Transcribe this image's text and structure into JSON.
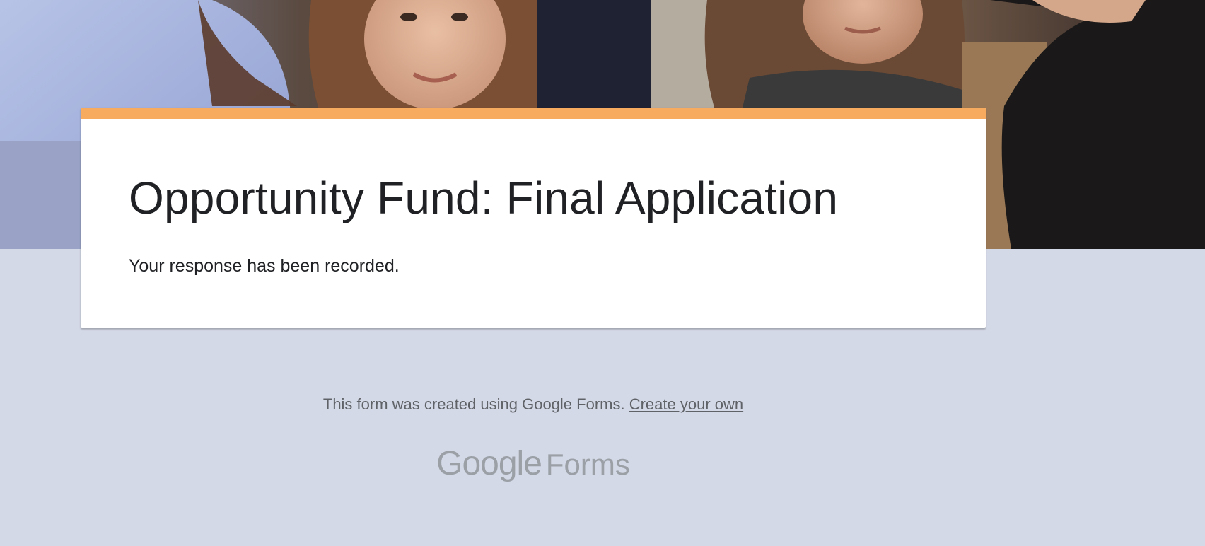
{
  "header": {
    "image": "group-of-people-banner",
    "accent_color": "#f6ab5f"
  },
  "form": {
    "title": "Opportunity Fund: Final Application",
    "confirmation_message": "Your response has been recorded."
  },
  "footer": {
    "disclaimer": "This form was created using Google Forms.",
    "create_link": "Create your own",
    "logo_google": "Google",
    "logo_forms": "Forms"
  },
  "colors": {
    "page_background": "#d4d9e7",
    "card_background": "#ffffff",
    "title_text": "#202124",
    "footer_text": "#5f6368",
    "logo_text": "#9aa0a6"
  }
}
